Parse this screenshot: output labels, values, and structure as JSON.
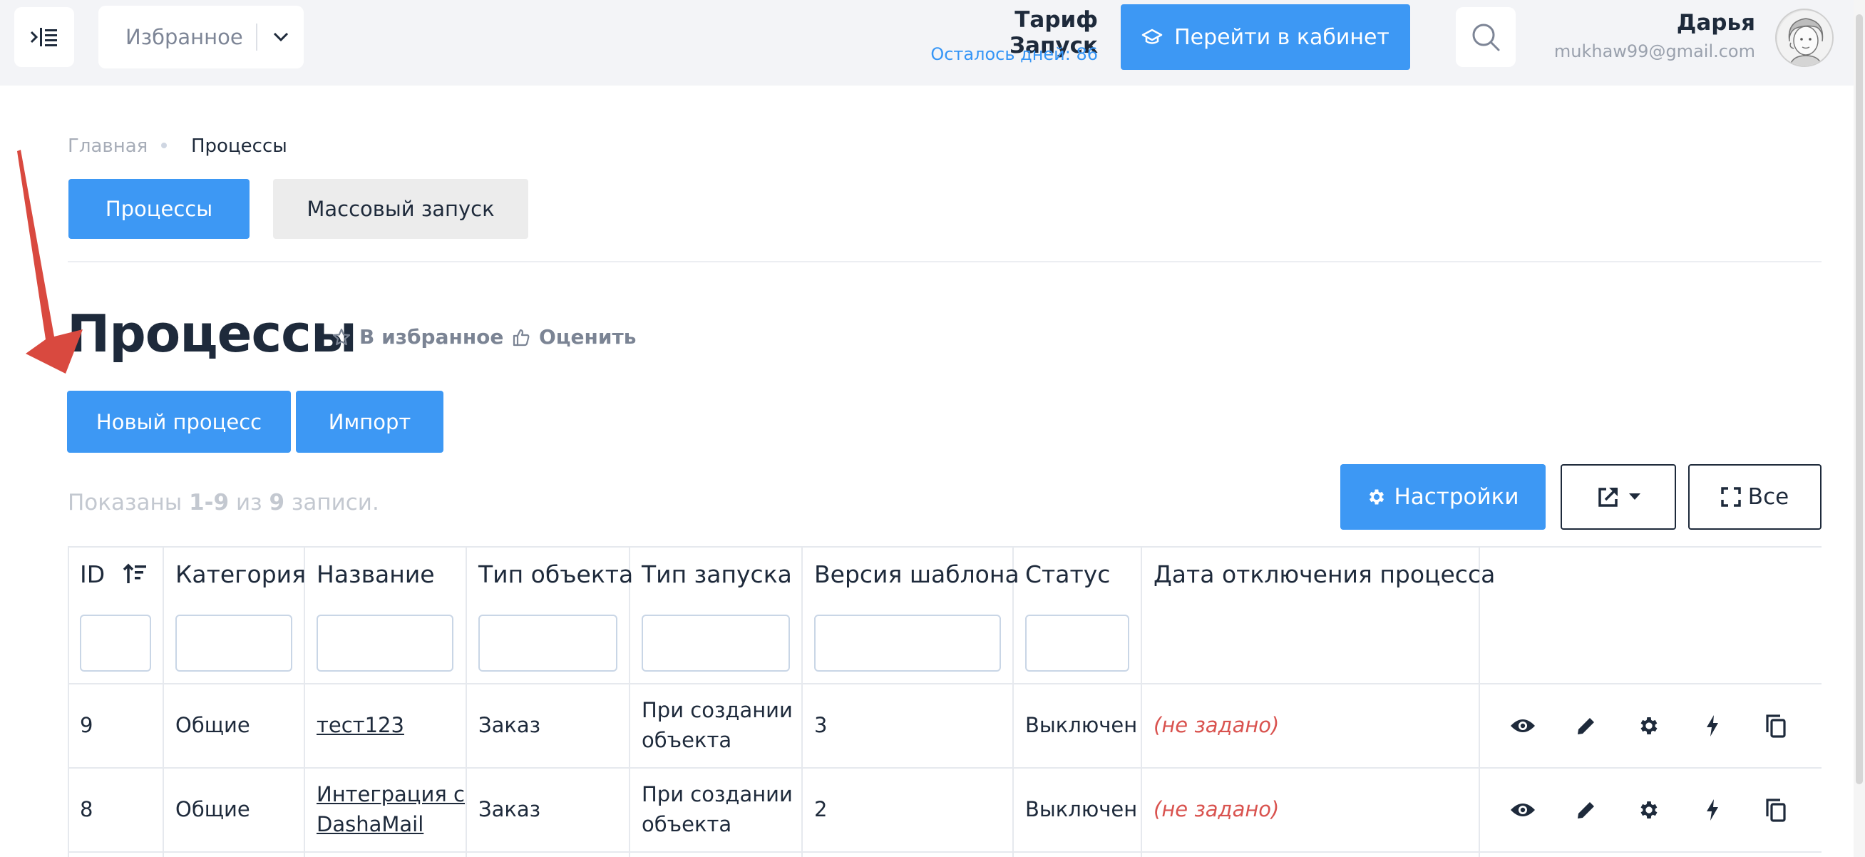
{
  "header": {
    "favorites_label": "Избранное",
    "tariff_title": "Тариф Запуск",
    "tariff_days": "Осталось дней: 86",
    "cabinet_button": "Перейти в кабинет",
    "user_name": "Дарья",
    "user_email": "mukhaw99@gmail.com"
  },
  "breadcrumb": {
    "home": "Главная",
    "current": "Процессы"
  },
  "tabs": [
    {
      "label": "Процессы",
      "active": true
    },
    {
      "label": "Массовый запуск",
      "active": false
    }
  ],
  "page": {
    "title": "Процессы",
    "favorite_link": "В избранное",
    "rate_link": "Оценить",
    "new_process_button": "Новый процесс",
    "import_button": "Импорт",
    "shown_prefix": "Показаны ",
    "shown_range": "1-9",
    "shown_mid": " из ",
    "shown_total": "9",
    "shown_suffix": " записи.",
    "settings_button": "Настройки",
    "all_button": "Все"
  },
  "table": {
    "columns": [
      "ID",
      "Категория",
      "Название",
      "Тип объекта",
      "Тип запуска",
      "Версия шаблона",
      "Статус",
      "Дата отключения процесса"
    ],
    "rows": [
      {
        "id": "9",
        "category": "Общие",
        "name_line1": "тест123",
        "name_line2": "",
        "object_type": "Заказ",
        "launch_line1": "При создании",
        "launch_line2": "объекта",
        "version": "3",
        "status": "Выключен",
        "disable_date": "(не задано)"
      },
      {
        "id": "8",
        "category": "Общие",
        "name_line1": "Интеграция с",
        "name_line2": "DashaMail",
        "object_type": "Заказ",
        "launch_line1": "При создании",
        "launch_line2": "объекта",
        "version": "2",
        "status": "Выключен",
        "disable_date": "(не задано)"
      }
    ]
  },
  "colors": {
    "accent": "#3d98f4",
    "text": "#1e2a3b",
    "muted": "#7b8494",
    "danger": "#d9534f",
    "arrow": "#d9493f"
  },
  "icons": [
    "sidebar-toggle-icon",
    "chevron-down-icon",
    "graduation-cap-icon",
    "search-icon",
    "star-icon",
    "thumbs-up-icon",
    "gear-icon",
    "external-link-icon",
    "caret-down-icon",
    "fullscreen-icon",
    "sort-icon",
    "eye-icon",
    "pencil-icon",
    "bolt-icon",
    "copy-icon"
  ]
}
